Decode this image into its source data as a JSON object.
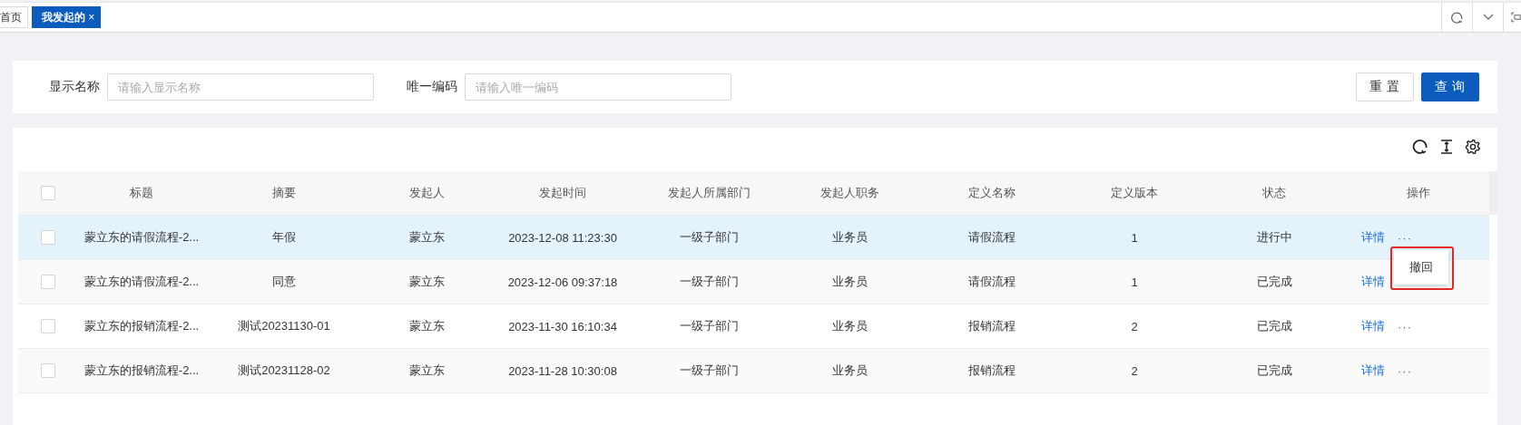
{
  "tabs": [
    {
      "label": "首页",
      "selected": false
    },
    {
      "label": "我发起的",
      "selected": true,
      "close": "×"
    }
  ],
  "search": {
    "fields": [
      {
        "label": "显示名称",
        "placeholder": "请输入显示名称"
      },
      {
        "label": "唯一编码",
        "placeholder": "请输入唯一编码"
      }
    ],
    "buttons": [
      {
        "label": "重 置",
        "kind": "default"
      },
      {
        "label": "查 询",
        "kind": "primary"
      }
    ]
  },
  "table": {
    "select_all_checked": false,
    "columns": [
      "标题",
      "摘要",
      "发起人",
      "发起时间",
      "发起人所属部门",
      "发起人职务",
      "定义名称",
      "定义版本",
      "状态",
      "操作"
    ],
    "rows": [
      {
        "checked": false,
        "hovered": true,
        "cells": [
          "蒙立东的请假流程-2...",
          "年假",
          "蒙立东",
          "2023-12-08 11:23:30",
          "一级子部门",
          "业务员",
          "请假流程",
          "1",
          "进行中"
        ],
        "detail": "详情",
        "more": "···"
      },
      {
        "checked": false,
        "hovered": false,
        "cells": [
          "蒙立东的请假流程-2...",
          "同意",
          "蒙立东",
          "2023-12-06 09:37:18",
          "一级子部门",
          "业务员",
          "请假流程",
          "1",
          "已完成"
        ],
        "detail": "详情"
      },
      {
        "checked": false,
        "hovered": false,
        "cells": [
          "蒙立东的报销流程-2...",
          "测试20231130-01",
          "蒙立东",
          "2023-11-30 16:10:34",
          "一级子部门",
          "业务员",
          "报销流程",
          "2",
          "已完成"
        ],
        "detail": "详情",
        "more": "···"
      },
      {
        "checked": false,
        "hovered": false,
        "cells": [
          "蒙立东的报销流程-2...",
          "测试20231128-02",
          "蒙立东",
          "2023-11-28 10:30:08",
          "一级子部门",
          "业务员",
          "报销流程",
          "2",
          "已完成"
        ],
        "detail": "详情",
        "more": "···"
      }
    ],
    "menu": {
      "items": [
        "撤回"
      ]
    }
  }
}
